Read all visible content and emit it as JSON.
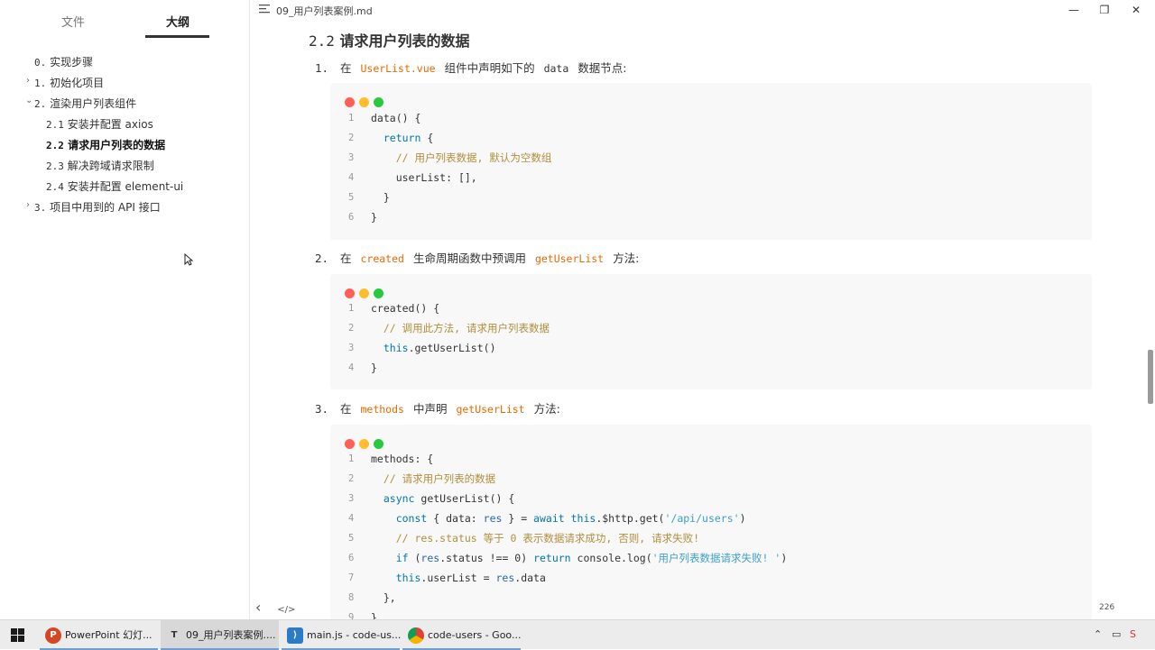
{
  "sidebar": {
    "tab_files": "文件",
    "tab_outline": "大纲",
    "items": [
      {
        "num": "0.",
        "label": "实现步骤"
      },
      {
        "num": "1.",
        "label": "初始化项目"
      },
      {
        "num": "2.",
        "label": "渲染用户列表组件"
      },
      {
        "num": "2.1",
        "label": "安装并配置 axios"
      },
      {
        "num": "2.2",
        "label": "请求用户列表的数据"
      },
      {
        "num": "2.3",
        "label": "解决跨域请求限制"
      },
      {
        "num": "2.4",
        "label": "安装并配置 element-ui"
      },
      {
        "num": "3.",
        "label": "项目中用到的 API 接口"
      }
    ]
  },
  "window": {
    "title": "09_用户列表案例.md"
  },
  "content": {
    "heading_num": "2.2",
    "heading_text": "请求用户列表的数据",
    "step1": {
      "n": "1.",
      "pre": "在",
      "code1": "UserList.vue",
      "mid": "组件中声明如下的",
      "code2": "data",
      "post": "数据节点:"
    },
    "step2": {
      "n": "2.",
      "pre": "在",
      "code1": "created",
      "mid": "生命周期函数中预调用",
      "code2": "getUserList",
      "post": "方法:"
    },
    "step3": {
      "n": "3.",
      "pre": "在",
      "code1": "methods",
      "mid": "中声明",
      "code2": "getUserList",
      "post": "方法:"
    },
    "code1": {
      "line1": "data() {",
      "line2_kw": "return",
      "line2_rest": " {",
      "line3": "// 用户列表数据, 默认为空数组",
      "line4": "userList: [],",
      "line5": "}",
      "line6": "}"
    },
    "code2": {
      "line1": "created() {",
      "line2": "// 调用此方法, 请求用户列表数据",
      "line3_kw": "this",
      "line3_rest": ".getUserList()",
      "line4": "}"
    },
    "code3": {
      "line1": "methods: {",
      "line2": "// 请求用户列表的数据",
      "line3_kw": "async",
      "line3_rest": " getUserList() {",
      "line4_kw1": "const",
      "line4_a": " { data: ",
      "line4_var": "res",
      "line4_b": " } = ",
      "line4_kw2": "await",
      "line4_c": " ",
      "line4_kw3": "this",
      "line4_d": ".$http.get(",
      "line4_str": "'/api/users'",
      "line4_e": ")",
      "line5": "// res.status 等于 0 表示数据请求成功, 否则, 请求失败!",
      "line6_kw1": "if",
      "line6_a": " (",
      "line6_var": "res",
      "line6_b": ".status !== 0) ",
      "line6_kw2": "return",
      "line6_c": " console.log(",
      "line6_str": "'用户列表数据请求失败! '",
      "line6_d": ")",
      "line7_kw": "this",
      "line7_a": ".userList = ",
      "line7_var": "res",
      "line7_b": ".data",
      "line8": "},",
      "line9": "}"
    },
    "word_count": "226"
  },
  "footer": {
    "prev": "‹",
    "source": "</>"
  },
  "taskbar": {
    "items": [
      {
        "label": "PowerPoint 幻灯..."
      },
      {
        "label": "09_用户列表案例...."
      },
      {
        "label": "main.js - code-us..."
      },
      {
        "label": "code-users - Goo..."
      }
    ]
  },
  "colors": {
    "dot_red": "#ff5f56",
    "dot_yellow": "#ffbd2e",
    "dot_green": "#27c93f",
    "inline_code": "#e96900"
  }
}
